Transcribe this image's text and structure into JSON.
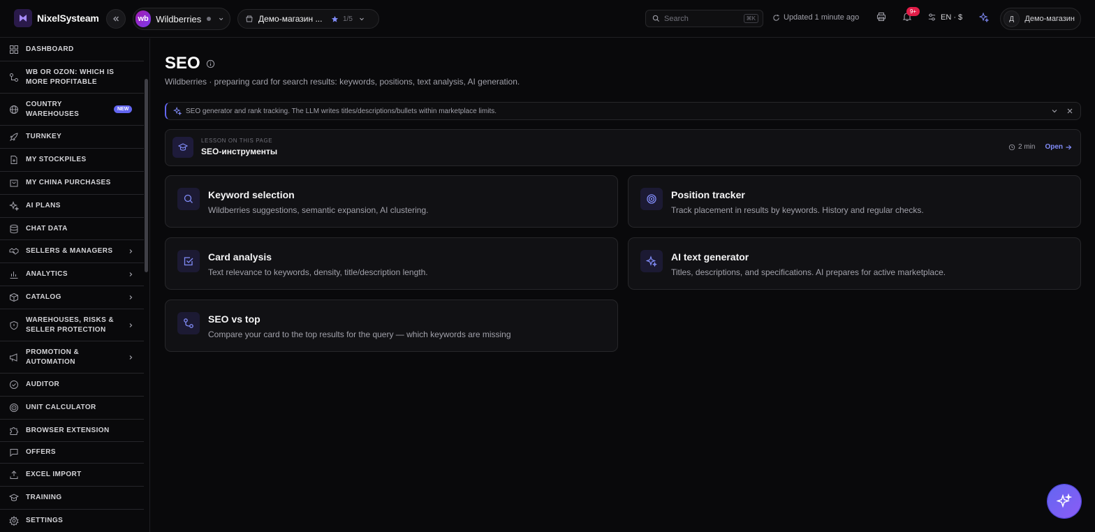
{
  "header": {
    "app_name": "NixelSysteam",
    "marketplace": {
      "logo_text": "wb",
      "name": "Wildberries"
    },
    "store": {
      "name": "Демо-магазин ...",
      "count": "1/5"
    },
    "search": {
      "placeholder": "Search",
      "shortcut": "⌘K"
    },
    "updated": "Updated 1 minute ago",
    "notifications_badge": "9+",
    "language_currency": "EN · $",
    "user": {
      "initial": "Д",
      "name": "Демо-магазин"
    }
  },
  "sidebar": {
    "items": [
      {
        "label": "Dashboard",
        "icon": "dashboard-icon"
      },
      {
        "label": "WB or Ozon: which is more profitable",
        "icon": "compare-icon"
      },
      {
        "label": "Country warehouses",
        "icon": "globe-icon",
        "badge": "NEW"
      },
      {
        "label": "Turnkey",
        "icon": "rocket-icon"
      },
      {
        "label": "My stockpiles",
        "icon": "file-icon"
      },
      {
        "label": "My China purchases",
        "icon": "bag-icon"
      },
      {
        "label": "AI plans",
        "icon": "sparkle-icon"
      },
      {
        "label": "Chat data",
        "icon": "database-icon"
      },
      {
        "label": "Sellers & managers",
        "icon": "handshake-icon",
        "has_children": true
      },
      {
        "label": "Analytics",
        "icon": "chart-icon",
        "has_children": true
      },
      {
        "label": "Catalog",
        "icon": "box-icon",
        "has_children": true
      },
      {
        "label": "Warehouses, risks & seller protection",
        "icon": "shield-icon",
        "has_children": true
      },
      {
        "label": "Promotion & automation",
        "icon": "megaphone-icon",
        "has_children": true
      },
      {
        "label": "Auditor",
        "icon": "check-circle-icon"
      },
      {
        "label": "Unit calculator",
        "icon": "target-icon"
      },
      {
        "label": "Browser extension",
        "icon": "puzzle-icon"
      },
      {
        "label": "Offers",
        "icon": "message-icon"
      },
      {
        "label": "Excel import",
        "icon": "upload-icon"
      },
      {
        "label": "Training",
        "icon": "graduation-icon"
      },
      {
        "label": "Settings",
        "icon": "gear-icon"
      }
    ]
  },
  "main": {
    "title": "SEO",
    "subtitle": "Wildberries · preparing card for search results: keywords, positions, text analysis, AI generation.",
    "banner": "SEO generator and rank tracking. The LLM writes titles/descriptions/bullets within marketplace limits.",
    "lesson": {
      "kicker": "Lesson on this page",
      "title": "SEO-инструменты",
      "duration": "2 min",
      "open_label": "Open"
    },
    "cards": [
      {
        "title": "Keyword selection",
        "desc": "Wildberries suggestions, semantic expansion, AI clustering.",
        "icon": "search-icon"
      },
      {
        "title": "Position tracker",
        "desc": "Track placement in results by keywords. History and regular checks.",
        "icon": "target-icon"
      },
      {
        "title": "Card analysis",
        "desc": "Text relevance to keywords, density, title/description length.",
        "icon": "checkbox-icon"
      },
      {
        "title": "AI text generator",
        "desc": "Titles, descriptions, and specifications. AI prepares for active marketplace.",
        "icon": "sparkle-icon"
      },
      {
        "title": "SEO vs top",
        "desc": "Compare your card to the top results for the query — which keywords are missing",
        "icon": "compare-icon"
      }
    ]
  },
  "colors": {
    "accent": "#818cf8",
    "badge": "#e11d48",
    "background": "#09090b"
  }
}
